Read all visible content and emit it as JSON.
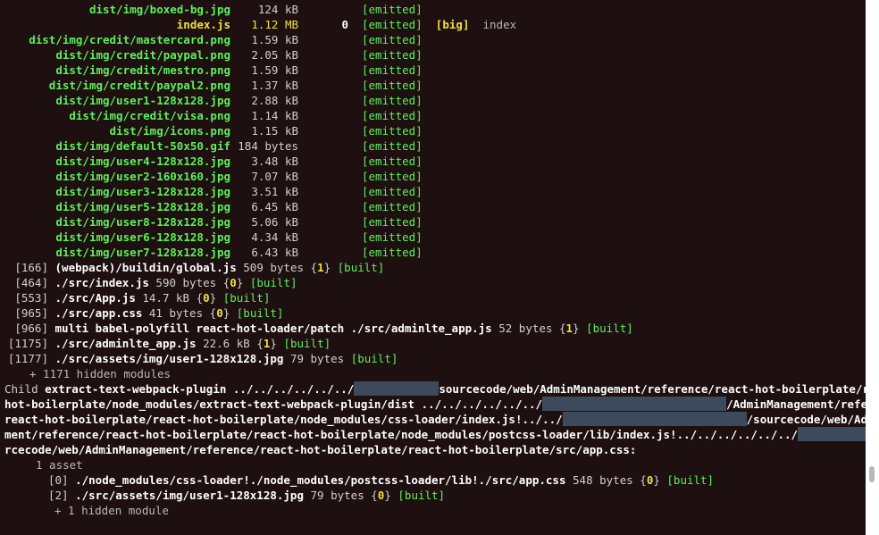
{
  "terminal": {
    "assets": [
      {
        "name": "dist/img/boxed-bg.jpg",
        "size": "124 kB",
        "status": "[emitted]"
      },
      {
        "name": "index.js",
        "size": "1.12 MB",
        "chunks": "0",
        "status": "[emitted]",
        "tag": "[big]",
        "chunk_name": "index"
      },
      {
        "name": "dist/img/credit/mastercard.png",
        "size": "1.59 kB",
        "status": "[emitted]"
      },
      {
        "name": "dist/img/credit/paypal.png",
        "size": "2.05 kB",
        "status": "[emitted]"
      },
      {
        "name": "dist/img/credit/mestro.png",
        "size": "1.59 kB",
        "status": "[emitted]"
      },
      {
        "name": "dist/img/credit/paypal2.png",
        "size": "1.37 kB",
        "status": "[emitted]"
      },
      {
        "name": "dist/img/user1-128x128.jpg",
        "size": "2.88 kB",
        "status": "[emitted]"
      },
      {
        "name": "dist/img/credit/visa.png",
        "size": "1.14 kB",
        "status": "[emitted]"
      },
      {
        "name": "dist/img/icons.png",
        "size": "1.15 kB",
        "status": "[emitted]"
      },
      {
        "name": "dist/img/default-50x50.gif",
        "size": "184 bytes",
        "status": "[emitted]"
      },
      {
        "name": "dist/img/user4-128x128.jpg",
        "size": "3.48 kB",
        "status": "[emitted]"
      },
      {
        "name": "dist/img/user2-160x160.jpg",
        "size": "7.07 kB",
        "status": "[emitted]"
      },
      {
        "name": "dist/img/user3-128x128.jpg",
        "size": "3.51 kB",
        "status": "[emitted]"
      },
      {
        "name": "dist/img/user5-128x128.jpg",
        "size": "6.45 kB",
        "status": "[emitted]"
      },
      {
        "name": "dist/img/user8-128x128.jpg",
        "size": "5.06 kB",
        "status": "[emitted]"
      },
      {
        "name": "dist/img/user6-128x128.jpg",
        "size": "4.34 kB",
        "status": "[emitted]"
      },
      {
        "name": "dist/img/user7-128x128.jpg",
        "size": "6.43 kB",
        "status": "[emitted]"
      }
    ],
    "modules": [
      {
        "id": "[166]",
        "path": "(webpack)/buildin/global.js",
        "size": "509 bytes",
        "chunk_open": "{",
        "chunk": "1",
        "chunk_close": "}",
        "status": "[built]"
      },
      {
        "id": "[464]",
        "path": "./src/index.js",
        "size": "590 bytes",
        "chunk_open": "{",
        "chunk": "0",
        "chunk_close": "}",
        "status": "[built]"
      },
      {
        "id": "[553]",
        "path": "./src/App.js",
        "size": "14.7 kB",
        "chunk_open": "{",
        "chunk": "0",
        "chunk_close": "}",
        "status": "[built]"
      },
      {
        "id": "[965]",
        "path": "./src/app.css",
        "size": "41 bytes",
        "chunk_open": "{",
        "chunk": "0",
        "chunk_close": "}",
        "status": "[built]"
      },
      {
        "id": "[966]",
        "path": "multi babel-polyfill react-hot-loader/patch ./src/adminlte_app.js",
        "size": "52 bytes",
        "chunk_open": "{",
        "chunk": "1",
        "chunk_close": "}",
        "status": "[built]"
      },
      {
        "id": "[1175]",
        "path": "./src/adminlte_app.js",
        "size": "22.6 kB",
        "chunk_open": "{",
        "chunk": "1",
        "chunk_close": "}",
        "status": "[built]"
      },
      {
        "id": "[1177]",
        "path": "./src/assets/img/user1-128x128.jpg",
        "size": "79 bytes",
        "status": "[built]"
      }
    ],
    "hidden_modules": "+ 1171 hidden modules",
    "child": {
      "prefix": "Child",
      "l1_a": "extract-text-webpack-plugin ../../../../../../",
      "l1_b": "sourcecode/web/AdminManagement/reference/react-hot-boilerplate/react-",
      "l2_a": "hot-boilerplate/node_modules/extract-text-webpack-plugin/dist ../../../../../../",
      "l2_b": "/AdminManagement/reference/",
      "l3_a": "react-hot-boilerplate/react-hot-boilerplate/node_modules/css-loader/index.js!../../",
      "l3_b": "/sourcecode/web/AdminManage",
      "l4_a": "ment/reference/react-hot-boilerplate/react-hot-boilerplate/node_modules/postcss-loader/lib/index.js!../../../../../../",
      "l5": "rcecode/web/AdminManagement/reference/react-hot-boilerplate/react-hot-boilerplate/src/app.css:",
      "asset_count": "1 asset",
      "modules": [
        {
          "id": "[0]",
          "path": "./node_modules/css-loader!./node_modules/postcss-loader/lib!./src/app.css",
          "size": "548 bytes",
          "chunk_open": "{",
          "chunk": "0",
          "chunk_close": "}",
          "status": "[built]"
        },
        {
          "id": "[2]",
          "path": "./src/assets/img/user1-128x128.jpg",
          "size": "79 bytes",
          "chunk_open": "{",
          "chunk": "0",
          "chunk_close": "}",
          "status": "[built]"
        }
      ],
      "hidden_module": "+ 1 hidden module"
    }
  },
  "colors": {
    "background": "#1e0f10",
    "green": "#5cf05c",
    "yellow": "#f0e040",
    "redaction": "#3c4a5c"
  }
}
